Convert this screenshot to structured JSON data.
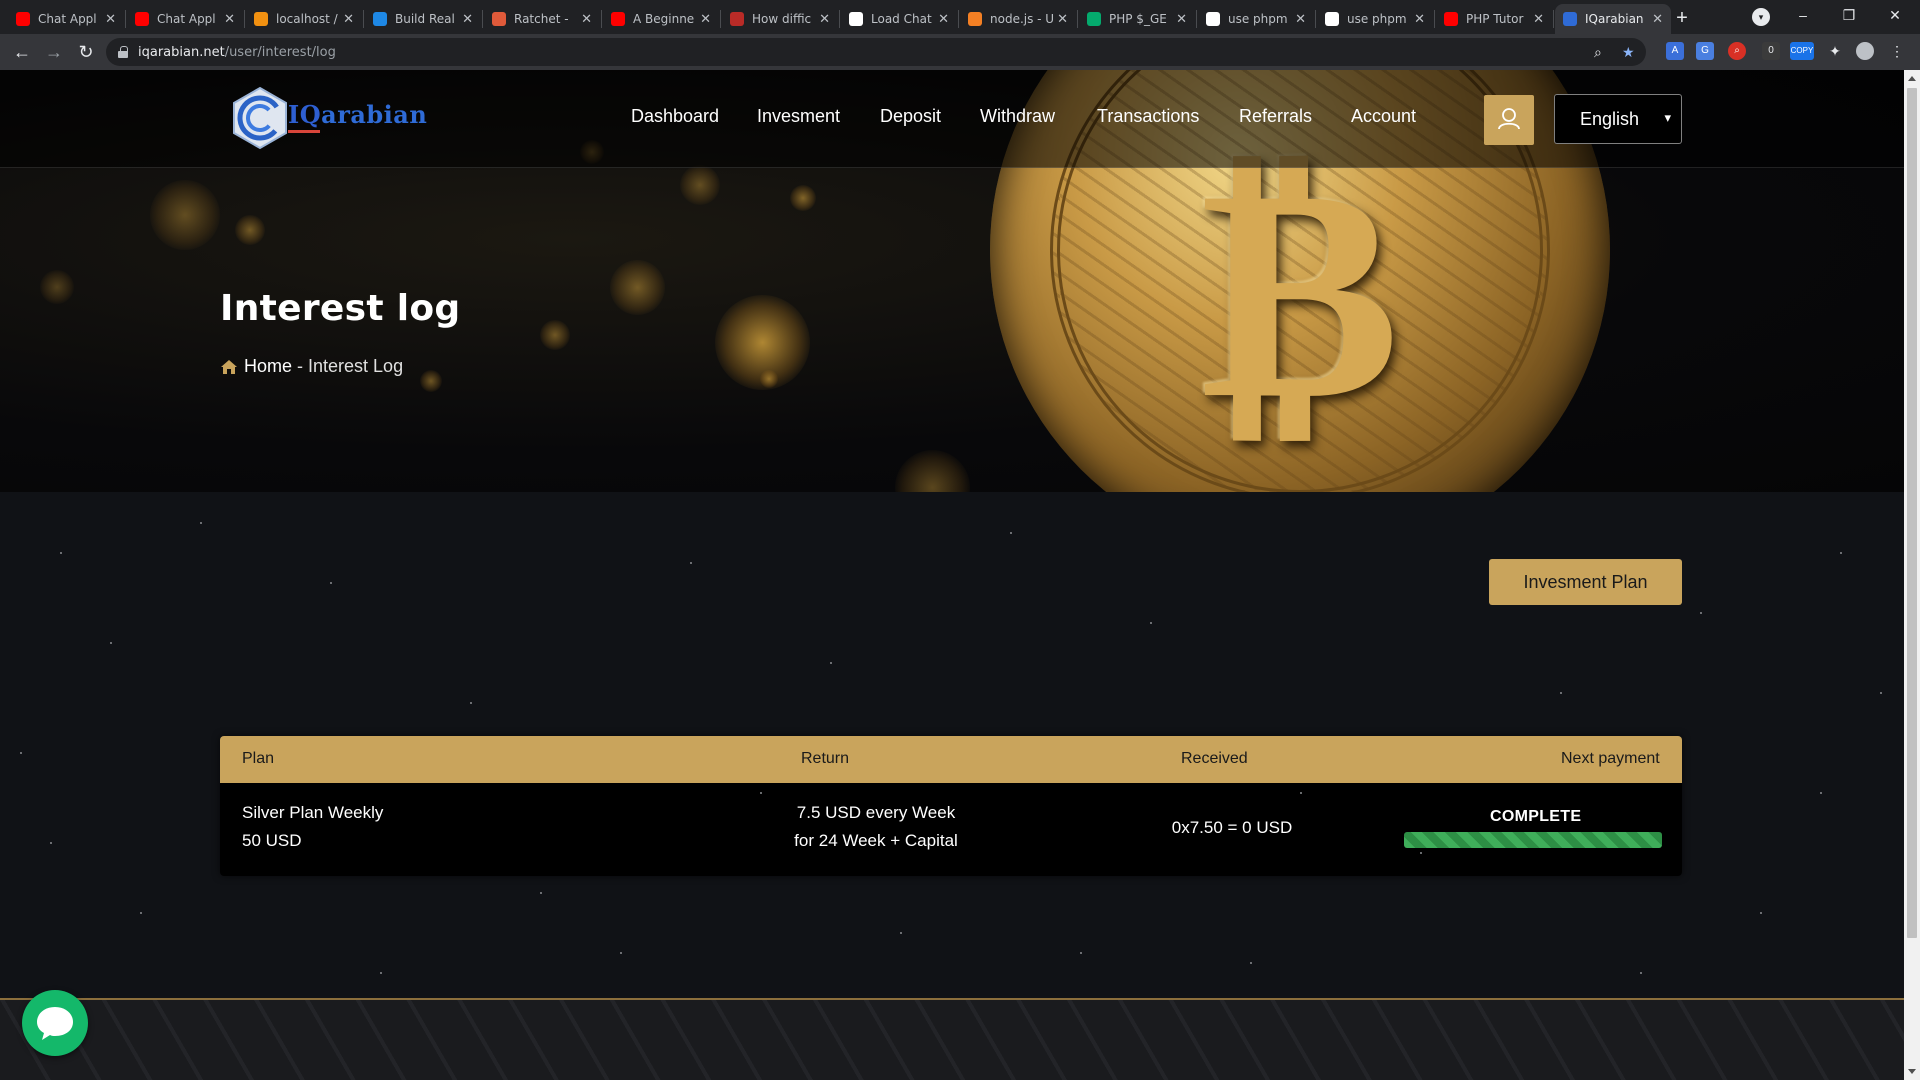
{
  "browser": {
    "tabs": [
      {
        "title": "Chat Appl",
        "icon": "youtube-icon",
        "color": "#ff0000"
      },
      {
        "title": "Chat Appl",
        "icon": "youtube-icon",
        "color": "#ff0000"
      },
      {
        "title": "localhost /",
        "icon": "phpmyadmin-icon",
        "color": "#f29111"
      },
      {
        "title": "Build Real",
        "icon": "w-icon",
        "color": "#1e88e5"
      },
      {
        "title": "Ratchet -",
        "icon": "ratchet-icon",
        "color": "#e05a3a"
      },
      {
        "title": "A Beginne",
        "icon": "youtube-icon",
        "color": "#ff0000"
      },
      {
        "title": "How diffic",
        "icon": "quora-icon",
        "color": "#b92b27"
      },
      {
        "title": "Load Chat",
        "icon": "stackexchange-icon",
        "color": "#ffffff"
      },
      {
        "title": "node.js - U",
        "icon": "stackoverflow-icon",
        "color": "#f48024"
      },
      {
        "title": "PHP $_GE",
        "icon": "w3schools-icon",
        "color": "#04aa6d"
      },
      {
        "title": "use phpm",
        "icon": "google-icon",
        "color": "#ffffff"
      },
      {
        "title": "use phpm",
        "icon": "google-icon",
        "color": "#ffffff"
      },
      {
        "title": "PHP Tutor",
        "icon": "youtube-icon",
        "color": "#ff0000"
      },
      {
        "title": "IQarabian",
        "icon": "iqarabian-icon",
        "color": "#2f6bd6"
      }
    ],
    "url_host": "iqarabian.net",
    "url_path": "/user/interest/log",
    "window_controls": {
      "minimize": "–",
      "restore": "❐",
      "close": "✕"
    }
  },
  "site": {
    "logo_iq": "IQ",
    "logo_rest": "arabian",
    "nav": [
      "Dashboard",
      "Invesment",
      "Deposit",
      "Withdraw",
      "Transactions",
      "Referrals",
      "Account"
    ],
    "language": "English",
    "page_title": "Interest log",
    "breadcrumb_home": "Home",
    "breadcrumb_sep": "-",
    "breadcrumb_current": "Interest Log",
    "plan_button": "Invesment Plan",
    "table": {
      "headers": [
        "Plan",
        "Return",
        "Received",
        "Next payment"
      ],
      "row": {
        "plan_name": "Silver Plan Weekly",
        "plan_amount": "50 USD",
        "return_line1": "7.5 USD every Week",
        "return_line2": "for 24 Week + Capital",
        "received": "0x7.50 = 0 USD",
        "status": "COMPLETE",
        "progress": 1.0
      }
    },
    "colors": {
      "accent": "#c9a45c",
      "progress": "#3fae5a",
      "chat": "#14b86a"
    }
  }
}
